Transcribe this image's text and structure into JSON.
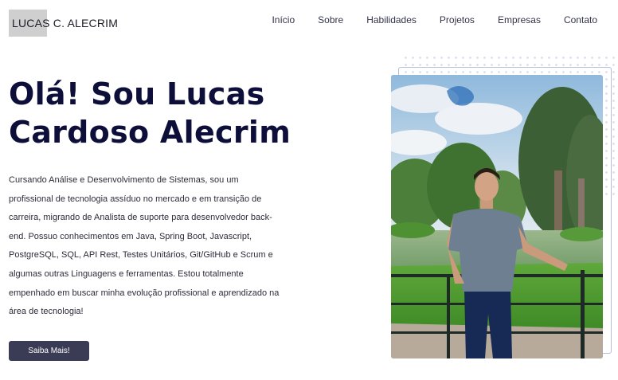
{
  "header": {
    "logo_text": "LUCAS C. ALECRIM",
    "nav": [
      {
        "label": "Início"
      },
      {
        "label": "Sobre"
      },
      {
        "label": "Habilidades"
      },
      {
        "label": "Projetos"
      },
      {
        "label": "Empresas"
      },
      {
        "label": "Contato"
      }
    ]
  },
  "hero": {
    "title_line1": "Olá! Sou Lucas",
    "title_line2": "Cardoso Alecrim",
    "description": "Cursando Análise e Desenvolvimento de Sistemas, sou um profissional de tecnologia assíduo no mercado e em transição de carreira, migrando de Analista de suporte para desenvolvedor back-end. Possuo conhecimentos em Java, Spring Boot, Javascript, PostgreSQL, SQL, API Rest, Testes Unitários, Git/GitHub e Scrum e algumas outras Linguagens e ferramentas. Estou totalmente empenhado em buscar minha evolução profissional e aprendizado na área de tecnologia!",
    "button_label": "Saiba Mais!"
  },
  "colors": {
    "title": "#0e0e3a",
    "button_bg": "#3a3b55",
    "frame_border": "#b8bdd8",
    "dots": "#dde2ee"
  }
}
